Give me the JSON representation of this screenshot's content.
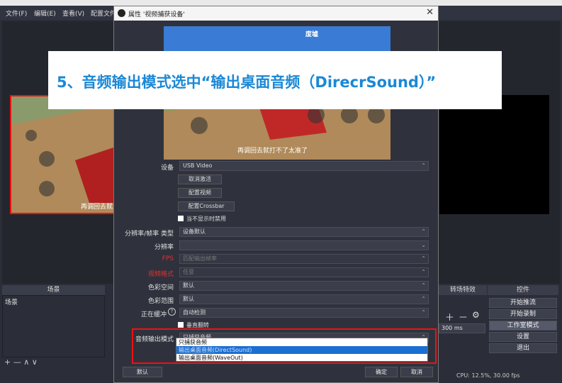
{
  "menu": {
    "file": "文件(F)",
    "edit": "编辑(E)",
    "view": "查看(V)",
    "profile": "配置文件"
  },
  "docks": {
    "scenes_title": "场景",
    "scenes_item": "场景",
    "transitions_title": "转场特效",
    "controls_title": "控件",
    "scene_controls": "+ —  ∧ ∨",
    "transition_duration": "300 ms"
  },
  "controls": [
    "开始推流",
    "开始录制",
    "工作室模式",
    "设置",
    "退出"
  ],
  "status": "CPU: 12.5%, 30.00 fps",
  "preview_overlay_text": "再调回去就",
  "dialog": {
    "title": "属性 '视频捕获设备'",
    "video_caption": "再调回去就打不了太准了",
    "video_top_badge": "废墟",
    "device_label": "设备",
    "device_value": "USB Video",
    "deactivate_button": "取消激活",
    "config_video_button": "配置视频",
    "config_crossbar_button": "配置Crossbar",
    "deactivate_hidden_check": "当不显示时禁用",
    "res_type_label": "分辨率/帧率 类型",
    "res_type_value": "设备默认",
    "resolution_label": "分辨率",
    "resolution_value": "",
    "fps_label": "FPS",
    "fps_value": "匹配输出帧率",
    "video_format_label": "视频格式",
    "video_format_value": "任意",
    "color_space_label": "色彩空间",
    "color_space_value": "默认",
    "color_range_label": "色彩范围",
    "color_range_value": "默认",
    "buffering_label": "正在缓冲",
    "buffering_value": "自动检测",
    "flip_check": "垂直翻转",
    "audio_mode_label": "音频输出模式",
    "audio_mode_value": "只捕获音频",
    "audio_options": [
      "只捕获音频",
      "输出桌面音频(DirectSound)",
      "输出桌面音频(WaveOut)"
    ],
    "defaults_button": "默认",
    "ok_button": "确定",
    "cancel_button": "取消"
  },
  "banner_text": "5、音频输出模式选中“输出桌面音频（DirecrSound）”"
}
